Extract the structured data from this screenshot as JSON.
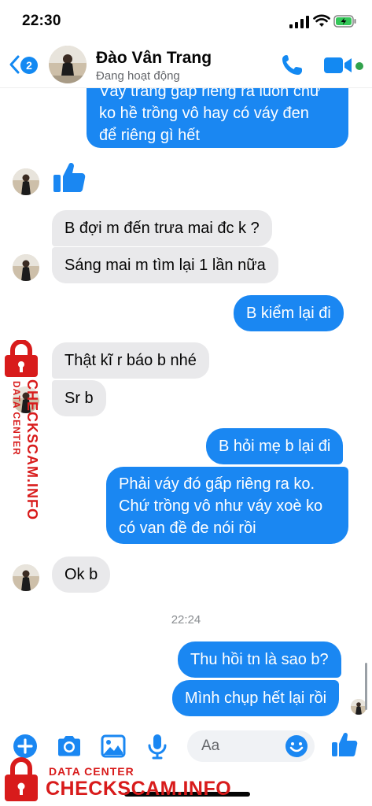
{
  "status_bar": {
    "time": "22:30"
  },
  "header": {
    "back_badge": "2",
    "contact_name": "Đào Vân Trang",
    "contact_status": "Đang hoạt động"
  },
  "messages": [
    {
      "sender": "me",
      "lines": [
        "Váy trắng gấp riêng ra luôn chứ",
        "ko hề trồng vô hay có váy đen",
        "để riêng gì hết"
      ]
    },
    {
      "sender": "contact",
      "type": "like"
    },
    {
      "sender": "contact",
      "text": "B đợi m đến trưa mai đc k ?"
    },
    {
      "sender": "contact",
      "text": "Sáng mai m tìm lại 1 lần nữa"
    },
    {
      "sender": "me",
      "text": "B kiểm lại đi"
    },
    {
      "sender": "contact",
      "text": "Thật kĩ r báo b nhé"
    },
    {
      "sender": "contact",
      "text": "Sr b"
    },
    {
      "sender": "me",
      "text": "B hỏi mẹ b lại đi"
    },
    {
      "sender": "me",
      "lines": [
        "Phải váy đó gấp riêng ra ko.",
        "Chứ trồng vô như váy xoè ko",
        "có van đề đe nói rồi"
      ]
    },
    {
      "sender": "contact",
      "text": "Ok b"
    },
    {
      "type": "timestamp",
      "text": "22:24"
    },
    {
      "sender": "me",
      "text": "Thu hồi tn là sao b?"
    },
    {
      "sender": "me",
      "text": "Mình chụp hết lại rồi"
    }
  ],
  "composer": {
    "placeholder": "Aa"
  },
  "watermark": {
    "label_small": "DATA CENTER",
    "label_large": "CHECKSCAM.INFO"
  },
  "colors": {
    "outgoing_bubble": "#1a87f2",
    "incoming_bubble": "#e9e9eb",
    "accent": "#1389f2",
    "watermark": "#d81b1b"
  },
  "icons": [
    "chevron-left-icon",
    "phone-icon",
    "video-camera-icon",
    "plus-circle-icon",
    "camera-icon",
    "image-icon",
    "microphone-icon",
    "emoji-icon",
    "thumbs-up-icon",
    "lock-icon"
  ]
}
